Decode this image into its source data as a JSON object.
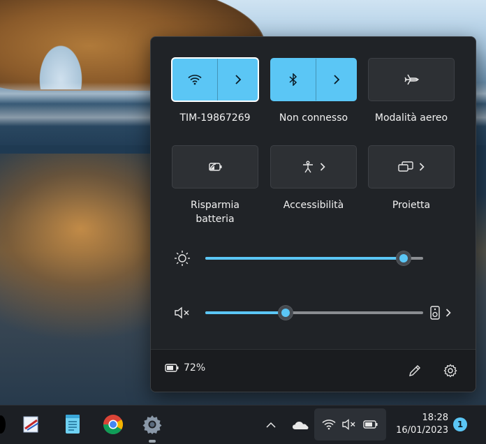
{
  "quick_settings": {
    "tiles_row1": [
      {
        "label": "TIM-19867269",
        "icon": "wifi-icon",
        "active": true
      },
      {
        "label": "Non connesso",
        "icon": "bluetooth-icon",
        "active": true
      },
      {
        "label": "Modalità aereo",
        "icon": "airplane-icon",
        "active": false
      }
    ],
    "tiles_row2": [
      {
        "label": "Risparmia batteria",
        "icon": "battery-saver-icon",
        "active": false
      },
      {
        "label": "Accessibilità",
        "icon": "accessibility-icon",
        "active": false
      },
      {
        "label": "Proietta",
        "icon": "project-icon",
        "active": false
      }
    ],
    "brightness": {
      "icon": "brightness-icon",
      "level": 0.91
    },
    "volume": {
      "icon": "volume-muted-icon",
      "level": 0.37,
      "output_icon": "speaker-icon"
    },
    "footer": {
      "battery_percent": "72%",
      "battery_icon": "battery-icon",
      "edit_icon": "pencil-icon",
      "settings_icon": "gear-icon"
    }
  },
  "taskbar": {
    "apps": [
      "paint-icon",
      "notepad-icon",
      "chrome-icon",
      "settings-app-icon"
    ],
    "tray_icons": [
      "chevron-up-icon",
      "onedrive-icon",
      "wifi-icon",
      "volume-muted-icon",
      "battery-icon"
    ],
    "time": "18:28",
    "date": "16/01/2023",
    "notifications": "1"
  },
  "colors": {
    "accent": "#5bc6f5",
    "panel_bg": "#202327",
    "taskbar_bg": "#1c1f24"
  }
}
